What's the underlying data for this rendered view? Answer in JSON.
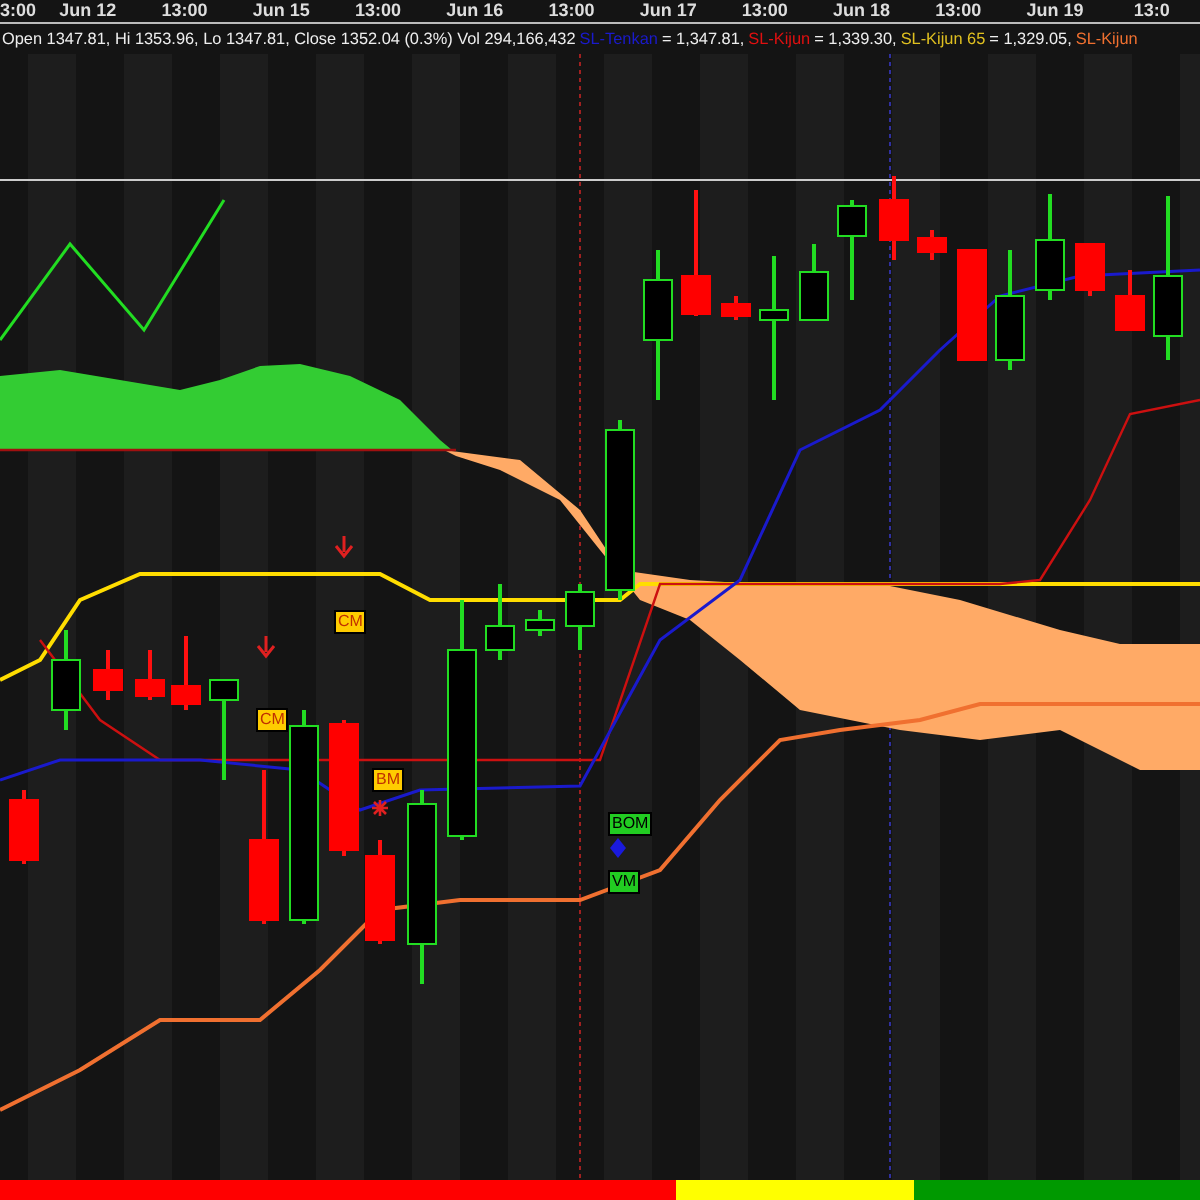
{
  "time_axis": {
    "labels": [
      "3:00",
      "Jun 12",
      "13:00",
      "Jun 15",
      "13:00",
      "Jun 16",
      "13:00",
      "Jun 17",
      "13:00",
      "Jun 18",
      "13:00",
      "Jun 19",
      "13:0"
    ]
  },
  "quote": {
    "text": "Open 1347.81, Hi 1353.96, Lo 1347.81, Close 1352.04 (0.3%) Vol 294,166,432"
  },
  "legend": [
    {
      "label": "SL-Tenkan",
      "value": "= 1,347.81,",
      "color": "#1a1acc"
    },
    {
      "label": "SL-Kijun",
      "value": "= 1,339.30,",
      "color": "#e01010"
    },
    {
      "label": "SL-Kijun 65",
      "value": "= 1,329.05,",
      "color": "#e0c020"
    },
    {
      "label": "SL-Kijun",
      "color": "#f07030"
    }
  ],
  "markers": [
    {
      "label": "CM",
      "color": "#ffcc00"
    },
    {
      "label": "CM",
      "color": "#ffcc00"
    },
    {
      "label": "BM",
      "color": "#ffcc00"
    },
    {
      "label": "BOM",
      "color": "#22cc22"
    },
    {
      "label": "VM",
      "color": "#22cc22"
    }
  ],
  "status_bar": [
    {
      "color": "#ff0000"
    },
    {
      "color": "#ffff00"
    },
    {
      "color": "#009900"
    }
  ]
}
